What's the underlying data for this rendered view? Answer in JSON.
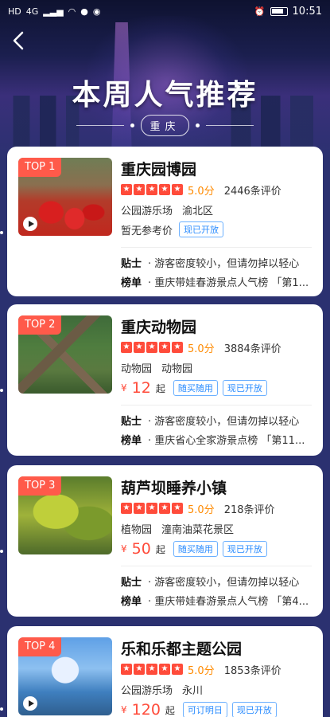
{
  "status_bar": {
    "left_icons": [
      "HD",
      "4G",
      "signal-icon",
      "wifi-icon",
      "wechat-icon",
      "message-icon"
    ],
    "time": "10:51"
  },
  "header": {
    "title": "本周人气推荐",
    "city": "重庆"
  },
  "colors": {
    "accent_red": "#ff4b3a",
    "score_orange": "#ff8a00",
    "chip_blue": "#2a8cff",
    "badge_red": "#ff5a4a"
  },
  "cards": [
    {
      "rank": "TOP 1",
      "name": "重庆园博园",
      "score": "5.0分",
      "reviews": "2446条评价",
      "tag1": "公园游乐场",
      "tag2": "渝北区",
      "price_none": "暂无参考价",
      "chips": [
        "现已开放"
      ],
      "tip_label": "贴士",
      "tip": "· 游客密度较小，但请勿掉以轻心",
      "rank_label": "榜单",
      "rank_text": "· 重庆带娃春游景点人气榜 「第1..."
    },
    {
      "rank": "TOP 2",
      "name": "重庆动物园",
      "score": "5.0分",
      "reviews": "3884条评价",
      "tag1": "动物园",
      "tag2": "动物园",
      "price_symbol": "¥",
      "price": "12",
      "price_unit": "起",
      "chips": [
        "随买随用",
        "现已开放"
      ],
      "tip_label": "贴士",
      "tip": "· 游客密度较小，但请勿掉以轻心",
      "rank_label": "榜单",
      "rank_text": "· 重庆省心全家游景点榜 「第11..."
    },
    {
      "rank": "TOP 3",
      "name": "葫芦坝睡养小镇",
      "score": "5.0分",
      "reviews": "218条评价",
      "tag1": "植物园",
      "tag2": "潼南油菜花景区",
      "price_symbol": "¥",
      "price": "50",
      "price_unit": "起",
      "chips": [
        "随买随用",
        "现已开放"
      ],
      "tip_label": "贴士",
      "tip": "· 游客密度较小，但请勿掉以轻心",
      "rank_label": "榜单",
      "rank_text": "· 重庆带娃春游景点人气榜 「第4..."
    },
    {
      "rank": "TOP 4",
      "name": "乐和乐都主题公园",
      "score": "5.0分",
      "reviews": "1853条评价",
      "tag1": "公园游乐场",
      "tag2": "永川",
      "price_symbol": "¥",
      "price": "120",
      "price_unit": "起",
      "chips": [
        "可订明日",
        "现已开放"
      ]
    }
  ]
}
